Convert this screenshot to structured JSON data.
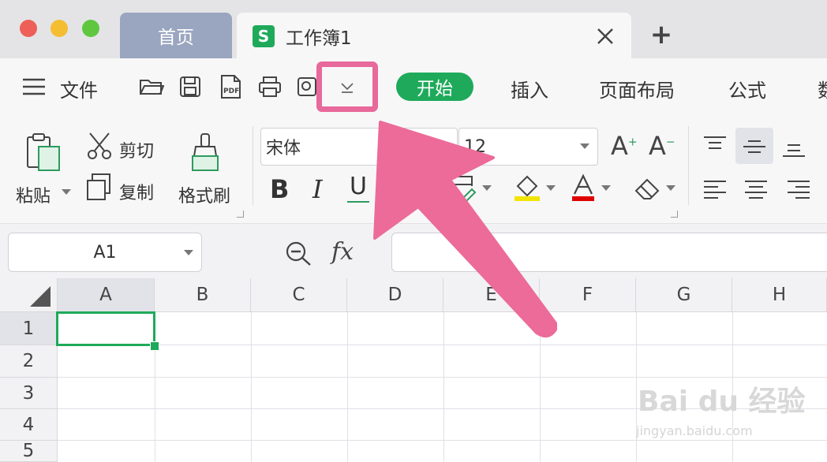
{
  "window": {
    "tabs": [
      {
        "label": "首页"
      },
      {
        "label": "工作簿1",
        "icon_letter": "S"
      }
    ],
    "new_tab_label": "+"
  },
  "menu": {
    "file_label": "文件",
    "start": "开始",
    "insert": "插入",
    "page_layout": "页面布局",
    "formula": "公式",
    "cut_off": "数"
  },
  "ribbon": {
    "paste": "粘贴",
    "cut": "剪切",
    "copy": "复制",
    "format_painter": "格式刷",
    "font_name": "宋体",
    "font_size": "12",
    "grow_glyph": "A",
    "shrink_glyph": "A",
    "bold": "B",
    "italic": "I",
    "underline": "U"
  },
  "formula_bar": {
    "name_box": "A1",
    "fx": "fx"
  },
  "grid": {
    "columns": [
      "A",
      "B",
      "C",
      "D",
      "E",
      "F",
      "G",
      "H"
    ],
    "rows": [
      "1",
      "2",
      "3",
      "4",
      "5"
    ]
  },
  "watermark": {
    "main": "Bai du 经验",
    "sub": "jingyan.baidu.com"
  },
  "colors": {
    "accent": "#1eaa5a",
    "highlight": "#e8699b",
    "home_tab": "#9aa5bf"
  }
}
